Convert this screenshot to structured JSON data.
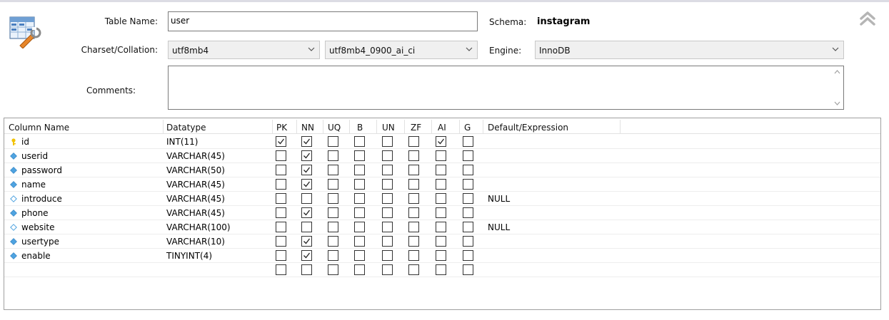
{
  "header": {
    "table_name_label": "Table Name:",
    "table_name_value": "user",
    "charset_label": "Charset/Collation:",
    "charset_value": "utf8mb4",
    "collation_value": "utf8mb4_0900_ai_ci",
    "comments_label": "Comments:",
    "comments_value": "",
    "schema_label": "Schema:",
    "schema_value": "instagram",
    "engine_label": "Engine:",
    "engine_value": "InnoDB"
  },
  "icons": {
    "table": "table-edit-icon",
    "collapse": "double-chevron-up-icon",
    "dropdown": "chevron-down-icon",
    "primary_key": "key-icon",
    "column_filled": "diamond-filled-icon",
    "column_empty": "diamond-outline-icon"
  },
  "colors": {
    "key": "#f2c200",
    "diamond": "#4fa3e0"
  },
  "grid": {
    "columns": [
      "Column Name",
      "Datatype",
      "PK",
      "NN",
      "UQ",
      "B",
      "UN",
      "ZF",
      "AI",
      "G",
      "Default/Expression"
    ],
    "rows": [
      {
        "name": "id",
        "icon": "key",
        "type": "INT(11)",
        "flags": [
          true,
          true,
          false,
          false,
          false,
          false,
          true,
          false
        ],
        "default": ""
      },
      {
        "name": "userid",
        "icon": "filled",
        "type": "VARCHAR(45)",
        "flags": [
          false,
          true,
          false,
          false,
          false,
          false,
          false,
          false
        ],
        "default": ""
      },
      {
        "name": "password",
        "icon": "filled",
        "type": "VARCHAR(50)",
        "flags": [
          false,
          true,
          false,
          false,
          false,
          false,
          false,
          false
        ],
        "default": ""
      },
      {
        "name": "name",
        "icon": "filled",
        "type": "VARCHAR(45)",
        "flags": [
          false,
          true,
          false,
          false,
          false,
          false,
          false,
          false
        ],
        "default": ""
      },
      {
        "name": "introduce",
        "icon": "empty",
        "type": "VARCHAR(45)",
        "flags": [
          false,
          false,
          false,
          false,
          false,
          false,
          false,
          false
        ],
        "default": "NULL"
      },
      {
        "name": "phone",
        "icon": "filled",
        "type": "VARCHAR(45)",
        "flags": [
          false,
          true,
          false,
          false,
          false,
          false,
          false,
          false
        ],
        "default": ""
      },
      {
        "name": "website",
        "icon": "empty",
        "type": "VARCHAR(100)",
        "flags": [
          false,
          false,
          false,
          false,
          false,
          false,
          false,
          false
        ],
        "default": "NULL"
      },
      {
        "name": "usertype",
        "icon": "filled",
        "type": "VARCHAR(10)",
        "flags": [
          false,
          true,
          false,
          false,
          false,
          false,
          false,
          false
        ],
        "default": ""
      },
      {
        "name": "enable",
        "icon": "filled",
        "type": "TINYINT(4)",
        "flags": [
          false,
          true,
          false,
          false,
          false,
          false,
          false,
          false
        ],
        "default": ""
      },
      {
        "name": "",
        "icon": "none",
        "type": "",
        "flags": [
          false,
          false,
          false,
          false,
          false,
          false,
          false,
          false
        ],
        "default": ""
      }
    ]
  }
}
